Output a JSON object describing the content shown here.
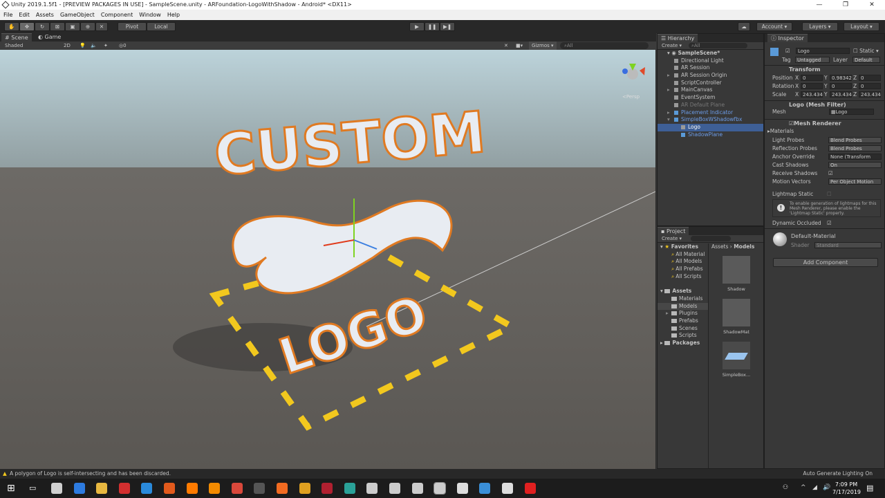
{
  "window": {
    "title": "Unity 2019.1.5f1 - [PREVIEW PACKAGES IN USE] - SampleScene.unity - ARFoundation-LogoWithShadow - Android* <DX11>",
    "controls": [
      "—",
      "❐",
      "✕"
    ]
  },
  "menu": [
    "File",
    "Edit",
    "Assets",
    "GameObject",
    "Component",
    "Window",
    "Help"
  ],
  "toolbar": {
    "tools": [
      "hand-tool",
      "move-tool",
      "rotate-tool",
      "scale-tool",
      "rect-tool",
      "transform-tool",
      "custom-tool"
    ],
    "pivot": "Pivot",
    "local": "Local",
    "account": "Account",
    "layers": "Layers",
    "layout": "Layout"
  },
  "scene": {
    "tabs": [
      "Scene",
      "Game"
    ],
    "shading": "Shaded",
    "mode_2d": "2D",
    "gizmos": "Gizmos",
    "search_placeholder": "All",
    "persp": "Persp",
    "overlay_count": "0",
    "logo_text": [
      "CUSTOM",
      "LOGO"
    ],
    "accent_yellow": "#f2c81e",
    "outline_orange": "#e07a22"
  },
  "hierarchy": {
    "title": "Hierarchy",
    "create": "Create",
    "search_placeholder": "All",
    "scene": "SampleScene*",
    "items": [
      {
        "label": "Directional Light",
        "depth": 1,
        "state": "normal"
      },
      {
        "label": "AR Session",
        "depth": 1,
        "state": "normal"
      },
      {
        "label": "AR Session Origin",
        "depth": 1,
        "state": "normal",
        "expandable": true
      },
      {
        "label": "ScriptController",
        "depth": 1,
        "state": "normal"
      },
      {
        "label": "MainCanvas",
        "depth": 1,
        "state": "normal",
        "expandable": true
      },
      {
        "label": "EventSystem",
        "depth": 1,
        "state": "normal"
      },
      {
        "label": "AR Default Plane",
        "depth": 1,
        "state": "disabled"
      },
      {
        "label": "Placement Indicator",
        "depth": 1,
        "state": "prefab",
        "expandable": true
      },
      {
        "label": "SimpleBoxWShadowfbx",
        "depth": 1,
        "state": "prefab",
        "expanded": true
      },
      {
        "label": "Logo",
        "depth": 2,
        "state": "selected"
      },
      {
        "label": "ShadowPlane",
        "depth": 2,
        "state": "prefab"
      }
    ]
  },
  "project": {
    "title": "Project",
    "create": "Create",
    "breadcrumb": [
      "Assets",
      "Models"
    ],
    "favorites_label": "Favorites",
    "favorites": [
      "All Material",
      "All Models",
      "All Prefabs",
      "All Scripts"
    ],
    "assets_label": "Assets",
    "folders": [
      "Materials",
      "Models",
      "Plugins",
      "Prefabs",
      "Scenes",
      "Scripts"
    ],
    "selected_folder": "Models",
    "packages_label": "Packages",
    "items": [
      "Shadow",
      "ShadowMat",
      "SimpleBox..."
    ]
  },
  "inspector": {
    "title": "Inspector",
    "name": "Logo",
    "active": true,
    "static_label": "Static",
    "tag_label": "Tag",
    "tag": "Untagged",
    "layer_label": "Layer",
    "layer": "Default",
    "transform": {
      "title": "Transform",
      "position_label": "Position",
      "rotation_label": "Rotation",
      "scale_label": "Scale",
      "position": [
        "0",
        "0.98342",
        "0"
      ],
      "rotation": [
        "0",
        "0",
        "0"
      ],
      "scale": [
        "243.434",
        "243.434",
        "243.434"
      ],
      "axes": [
        "X",
        "Y",
        "Z"
      ]
    },
    "mesh_filter": {
      "title": "Logo (Mesh Filter)",
      "mesh_label": "Mesh",
      "mesh": "Logo"
    },
    "mesh_renderer": {
      "title": "Mesh Renderer",
      "materials_label": "Materials",
      "props": [
        {
          "label": "Light Probes",
          "value": "Blend Probes"
        },
        {
          "label": "Reflection Probes",
          "value": "Blend Probes"
        },
        {
          "label": "Anchor Override",
          "value": "None (Transform"
        },
        {
          "label": "Cast Shadows",
          "value": "On"
        },
        {
          "label": "Receive Shadows",
          "checked": true
        },
        {
          "label": "Motion Vectors",
          "value": "Per Object Motion"
        }
      ],
      "lightmap_static_label": "Lightmap Static",
      "lightmap_static": false,
      "info": "To enable generation of lightmaps for this Mesh Renderer, please enable the 'Lightmap Static' property.",
      "dynamic_occluded_label": "Dynamic Occluded",
      "dynamic_occluded": true
    },
    "material": {
      "name": "Default-Material",
      "shader_label": "Shader",
      "shader": "Standard"
    },
    "add_component": "Add Component"
  },
  "status": {
    "message": "A polygon of Logo is self-intersecting and has been discarded.",
    "right": "Auto Generate Lighting On"
  },
  "taskbar": {
    "time": "7:09 PM",
    "date": "7/17/2019",
    "apps": [
      "#d0d0d0",
      "#2d7be0",
      "#e8b840",
      "#d32f2f",
      "#2a8adb",
      "#e25a1c",
      "#ff7b00",
      "#f38b00",
      "#d9483b",
      "#555555",
      "#f26b21",
      "#e0a020",
      "#b02030",
      "#2aa198",
      "#cccccc",
      "#cccccc",
      "#cccccc",
      "#cccccc",
      "#dddddd",
      "#3a8fd8",
      "#dddddd",
      "#e02020"
    ]
  }
}
